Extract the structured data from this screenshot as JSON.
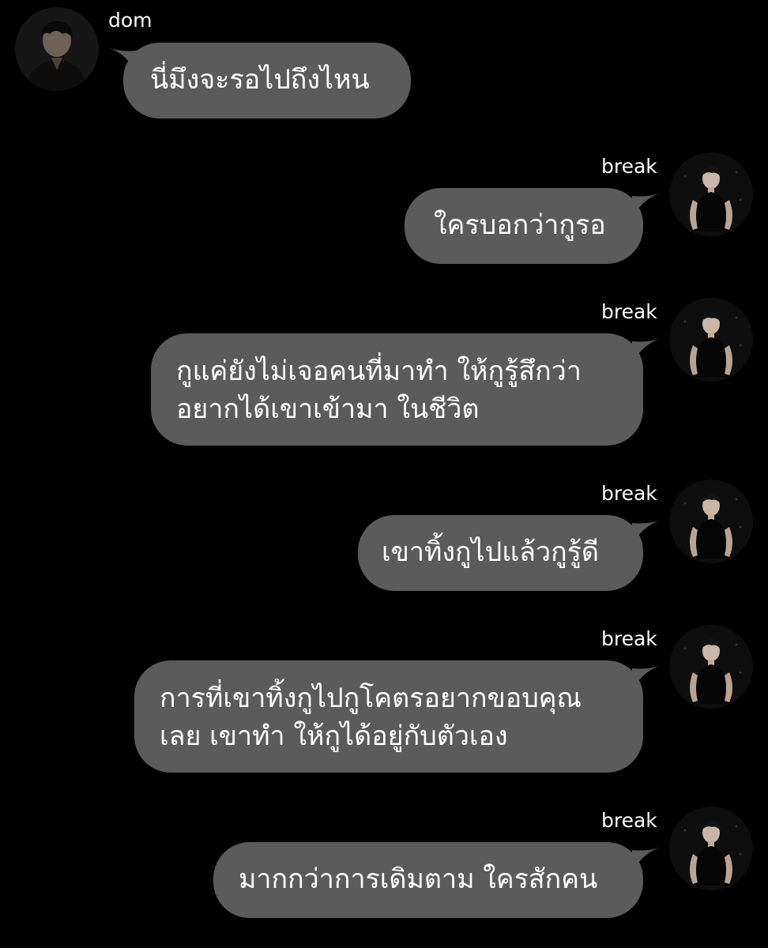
{
  "colors": {
    "background": "#000000",
    "bubble": "#5b5b5b",
    "text": "#ffffff"
  },
  "messages": [
    {
      "sender": "dom",
      "side": "left",
      "avatar": "profile-photo-dom",
      "lines": [
        "นี่มึงจะรอไปถึงไหน"
      ]
    },
    {
      "sender": "break",
      "side": "right",
      "avatar": "profile-photo-break",
      "lines": [
        "ใครบอกว่ากูรอ"
      ]
    },
    {
      "sender": "break",
      "side": "right",
      "avatar": "profile-photo-break",
      "lines": [
        "กูแค่ยังไม่เจอคนที่มาทำ ให้กูรู้สึกว่า",
        "อยากได้เขาเข้ามา ในชีวิต"
      ]
    },
    {
      "sender": "break",
      "side": "right",
      "avatar": "profile-photo-break",
      "lines": [
        "เขาทิ้งกูไปแล้วกูรู้ดี"
      ]
    },
    {
      "sender": "break",
      "side": "right",
      "avatar": "profile-photo-break",
      "lines": [
        "การที่เขาทิ้งกูไปกูโคตรอยากขอบคุณ",
        "เลย เขาทำ ให้กูได้อยู่กับตัวเอง"
      ]
    },
    {
      "sender": "break",
      "side": "right",
      "avatar": "profile-photo-break",
      "lines": [
        "มากกว่าการเดิมตาม ใครสักคน"
      ]
    }
  ]
}
